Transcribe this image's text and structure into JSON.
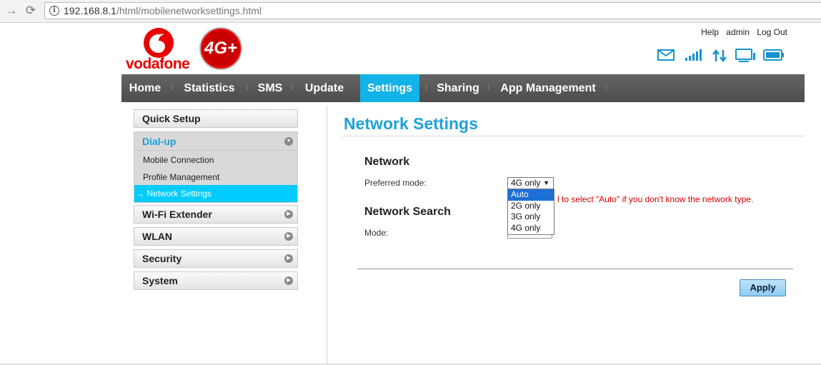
{
  "browser": {
    "url_host": "192.168.8.1",
    "url_path": "/html/mobilenetworksettings.html"
  },
  "brand": {
    "name": "vodafone",
    "badge": "4G+",
    "brand_red": "#e60000",
    "accent_blue": "#12b3e6"
  },
  "top_links": [
    "Help",
    "admin",
    "Log Out"
  ],
  "status_icons": [
    "mail-icon",
    "signal-icon",
    "data-transfer-icon",
    "wifi-devices-icon",
    "battery-icon"
  ],
  "menu": [
    {
      "label": "Home",
      "active": false
    },
    {
      "label": "Statistics",
      "active": false
    },
    {
      "label": "SMS",
      "active": false
    },
    {
      "label": "Update",
      "active": false
    },
    {
      "label": "Settings",
      "active": true
    },
    {
      "label": "Sharing",
      "active": false
    },
    {
      "label": "App Management",
      "active": false
    }
  ],
  "sidebar": {
    "quick_setup": "Quick Setup",
    "dialup": "Dial-up",
    "dialup_items": [
      "Mobile Connection",
      "Profile Management",
      "Network Settings"
    ],
    "active_prefix": "→",
    "wifi_extender": "Wi-Fi Extender",
    "wlan": "WLAN",
    "security": "Security",
    "system": "System"
  },
  "content": {
    "title": "Network Settings",
    "network_heading": "Network",
    "preferred_mode_label": "Preferred mode:",
    "preferred_mode_value": "4G only",
    "preferred_mode_options": [
      "Auto",
      "2G only",
      "3G only",
      "4G only"
    ],
    "highlighted_option": "Auto",
    "hint": "l to select \"Auto\" if you don't know the network type.",
    "search_heading": "Network Search",
    "mode_label": "Mode:",
    "apply_label": "Apply"
  }
}
